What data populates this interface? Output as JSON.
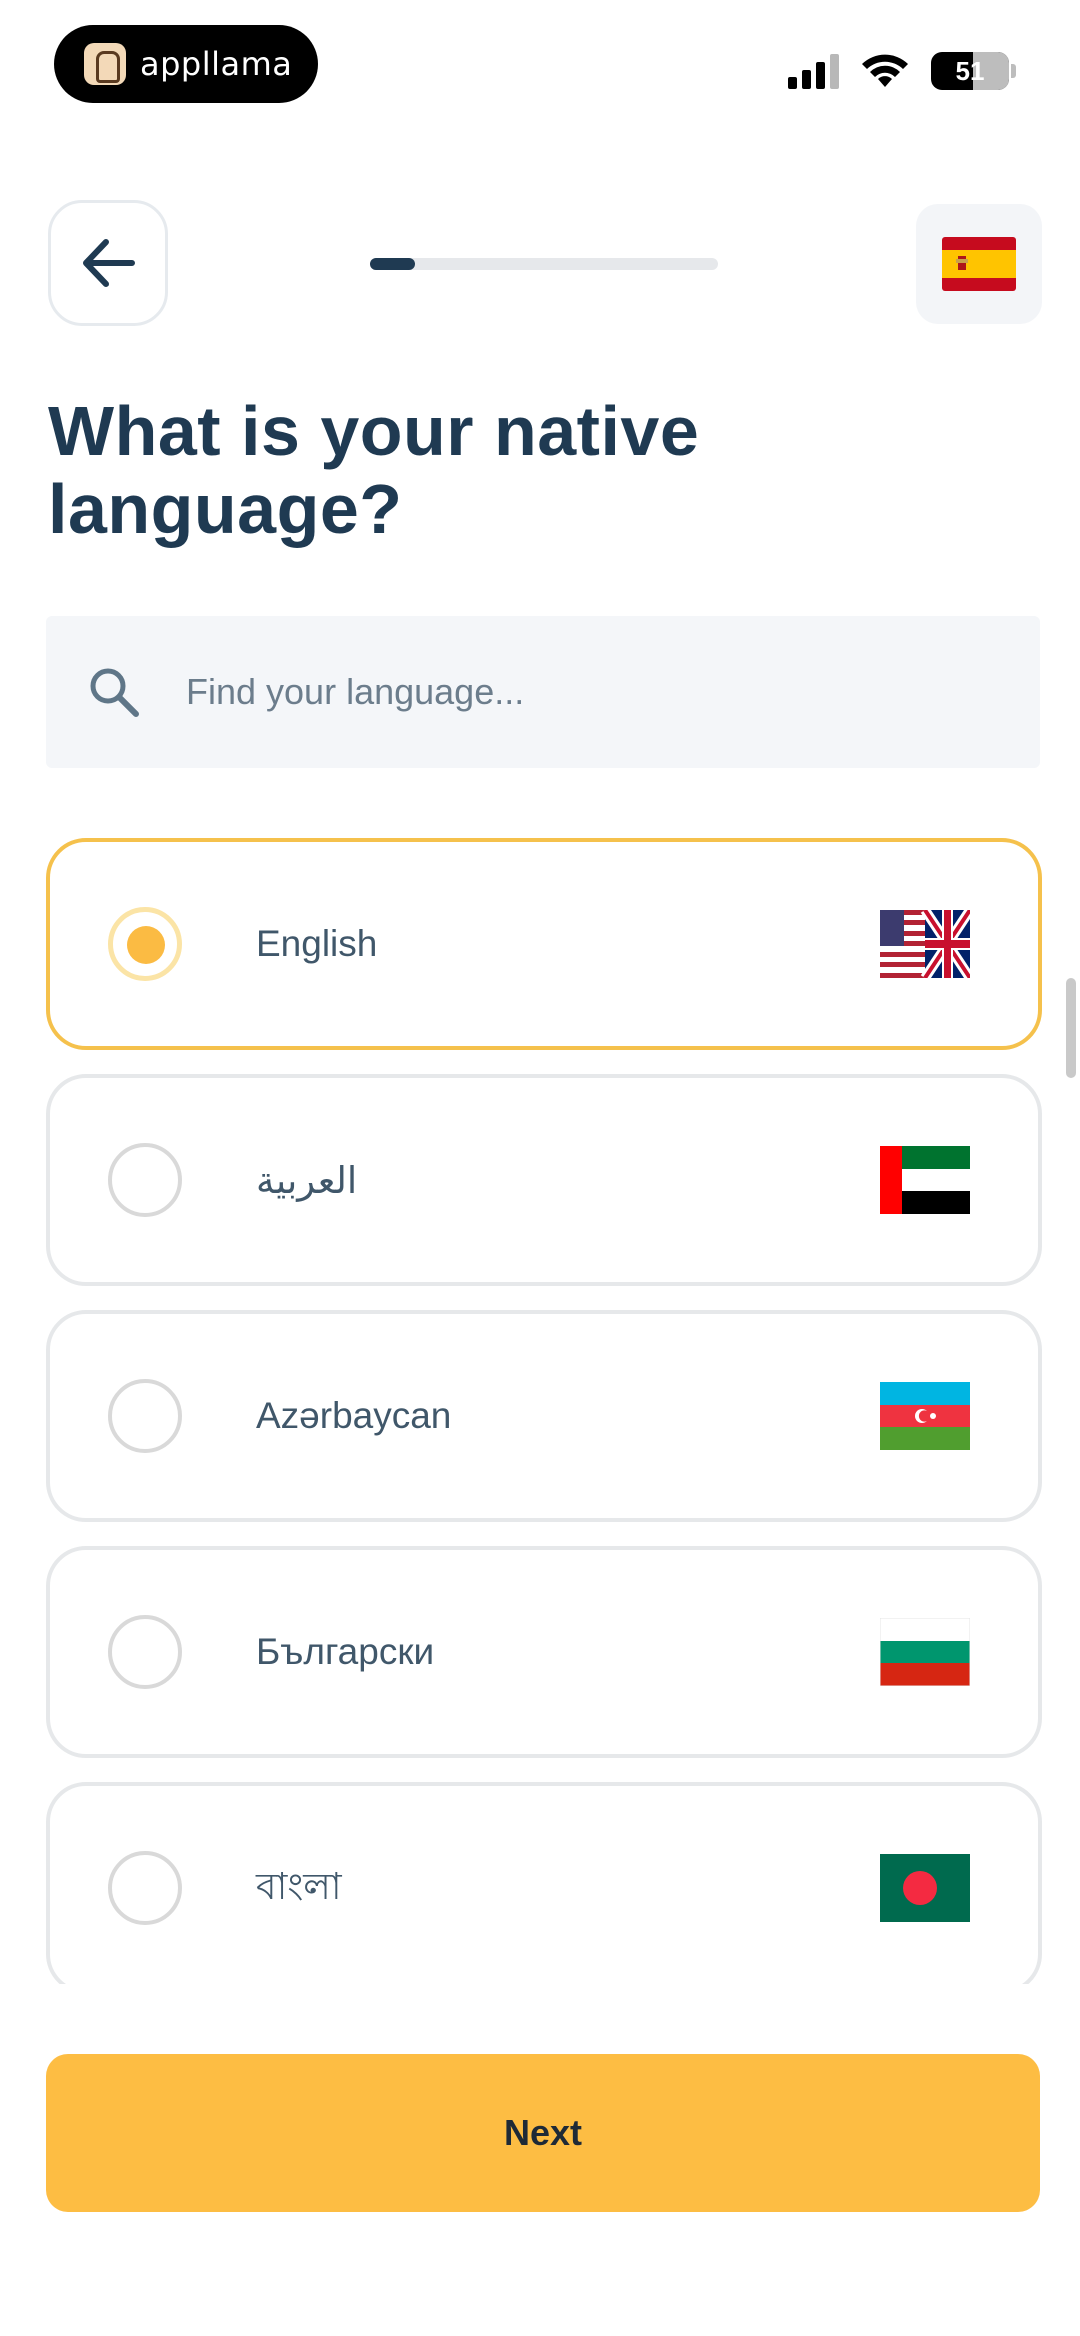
{
  "status_bar": {
    "app_name": "appllama",
    "battery": "51"
  },
  "header": {
    "back_icon": "arrow-left-icon",
    "progress": 0.13,
    "target_language_flag": "spain-flag"
  },
  "page": {
    "title": "What is your native language?"
  },
  "search": {
    "placeholder": "Find your language...",
    "value": ""
  },
  "languages": [
    {
      "label": "English",
      "flag": "us-uk-flag",
      "selected": true
    },
    {
      "label": "العربية",
      "flag": "uae-flag",
      "selected": false
    },
    {
      "label": "Azərbaycan",
      "flag": "azerbaijan-flag",
      "selected": false
    },
    {
      "label": "Български",
      "flag": "bulgaria-flag",
      "selected": false
    },
    {
      "label": "বাংলা",
      "flag": "bangladesh-flag",
      "selected": false
    }
  ],
  "footer": {
    "next_label": "Next"
  },
  "colors": {
    "accent": "#fdbd43",
    "primary_text": "#1f3a52",
    "selected_border": "#f5c14c"
  }
}
